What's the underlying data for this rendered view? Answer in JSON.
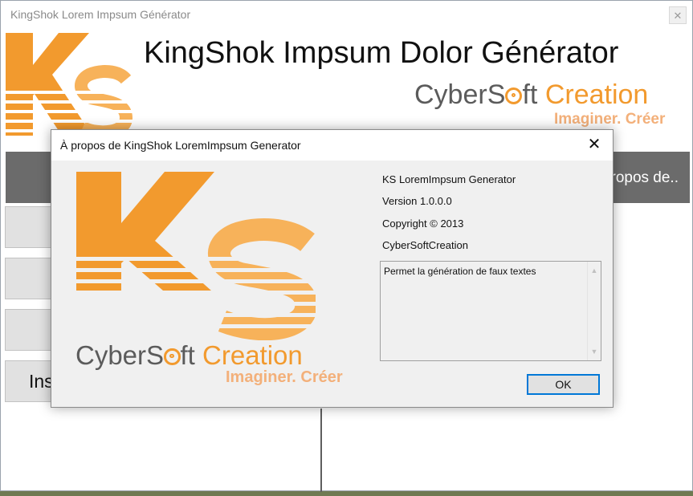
{
  "main_window": {
    "title": "KingShok Lorem Impsum Générator",
    "close_glyph": "✕",
    "header_title": "KingShok Impsum Dolor Générator",
    "brand": {
      "cyber": "Cyber",
      "s": "S",
      "ft": "ft ",
      "creation": "Creation",
      "tagline": "Imaginer. Créer"
    },
    "nav": {
      "apropos_label": "propos de.."
    },
    "side_buttons": [
      "",
      "",
      "",
      "Ins"
    ]
  },
  "about_dialog": {
    "title": "À propos de KingShok LoremImpsum Generator",
    "close_glyph": "✕",
    "product_name": "KS LoremImpsum Generator",
    "version": "Version 1.0.0.0",
    "copyright": "Copyright ©  2013",
    "company": "CyberSoftCreation",
    "description": "Permet la génération de faux textes",
    "ok_label": "OK",
    "brand": {
      "cyber": "Cyber",
      "s": "S",
      "ft": "ft ",
      "creation": "Creation",
      "tagline": "Imaginer. Créer"
    }
  },
  "colors": {
    "brand_orange": "#f29a2e",
    "brand_gray": "#5b5b5b",
    "nav_bar": "#6b6b6b",
    "focus_blue": "#0078d7"
  },
  "icons": {
    "logo": "ks-logo-icon",
    "close": "close-icon",
    "scroll_up": "scroll-up-arrow-icon",
    "scroll_down": "scroll-down-arrow-icon"
  }
}
